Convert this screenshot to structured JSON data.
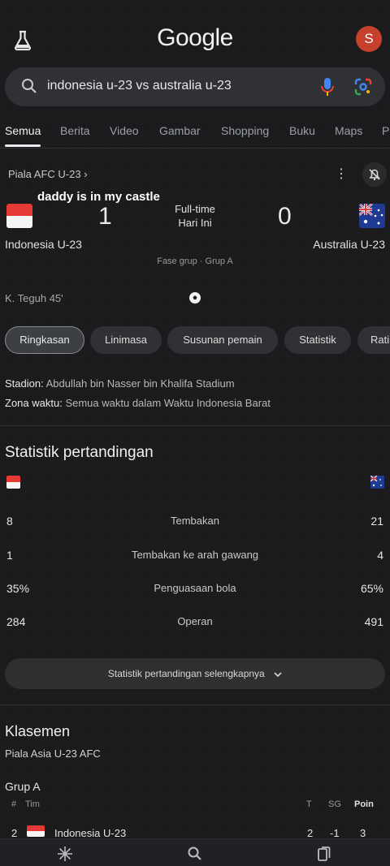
{
  "header": {
    "logo": "Google",
    "avatar_letter": "S"
  },
  "search": {
    "query": "indonesia u-23 vs australia u-23"
  },
  "tabs": [
    "Semua",
    "Berita",
    "Video",
    "Gambar",
    "Shopping",
    "Buku",
    "Maps",
    "P"
  ],
  "match": {
    "competition": "Piala AFC U-23 ›",
    "overlay_text": "daddy is in my castle",
    "home": {
      "name": "Indonesia U-23",
      "score": "1"
    },
    "away": {
      "name": "Australia U-23",
      "score": "0"
    },
    "status_line1": "Full-time",
    "status_line2": "Hari Ini",
    "stage": "Fase grup · Grup A",
    "scorer": "K. Teguh 45'"
  },
  "chips": [
    "Ringkasan",
    "Linimasa",
    "Susunan pemain",
    "Statistik",
    "Rati"
  ],
  "info": {
    "stadium_label": "Stadion:",
    "stadium_value": "Abdullah bin Nasser bin Khalifa Stadium",
    "tz_label": "Zona waktu:",
    "tz_value": "Semua waktu dalam Waktu Indonesia Barat"
  },
  "stats": {
    "title": "Statistik pertandingan",
    "rows": [
      {
        "home": "8",
        "label": "Tembakan",
        "away": "21"
      },
      {
        "home": "1",
        "label": "Tembakan ke arah gawang",
        "away": "4"
      },
      {
        "home": "35%",
        "label": "Penguasaan bola",
        "away": "65%"
      },
      {
        "home": "284",
        "label": "Operan",
        "away": "491"
      }
    ],
    "more_label": "Statistik pertandingan selengkapnya"
  },
  "standings": {
    "title": "Klasemen",
    "subtitle": "Piala Asia U-23 AFC",
    "group": "Grup A",
    "headers": {
      "rank": "#",
      "team": "Tim",
      "played": "T",
      "gd": "SG",
      "points": "Poin"
    },
    "row": {
      "rank": "2",
      "team": "Indonesia U-23",
      "played": "2",
      "gd": "-1",
      "points": "3"
    }
  },
  "colors": {
    "background": "#1a1a1c",
    "avatar": "#c5402d",
    "indonesia_red": "#e53935",
    "australia_blue": "#1f3a93"
  }
}
